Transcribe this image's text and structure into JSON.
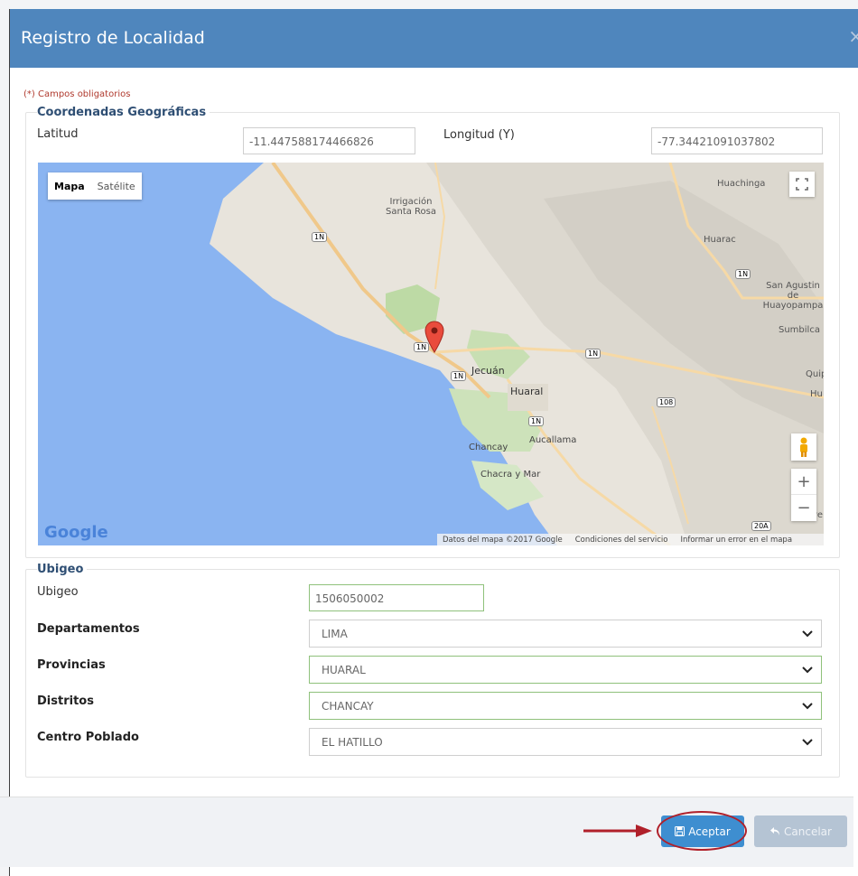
{
  "dialog": {
    "title": "Registro de Localidad",
    "close_symbol": "×",
    "required_note": "(*) Campos obligatorios"
  },
  "coords": {
    "legend": "Coordenadas Geográficas",
    "lat_label": "Latitud",
    "lat_value": "-11.447588174466826",
    "lon_label": "Longitud (Y)",
    "lon_value": "-77.34421091037802"
  },
  "map": {
    "type_map": "Mapa",
    "type_satellite": "Satélite",
    "google_logo": "Google",
    "attribution_data": "Datos del mapa ©2017 Google",
    "attribution_terms": "Condiciones del servicio",
    "attribution_report": "Informar un error en el mapa",
    "places": {
      "irrigacion_1": "Irrigación",
      "irrigacion_2": "Santa Rosa",
      "huachinga": "Huachinga",
      "huarac": "Huarac",
      "san_agustin_1": "San Agustin de",
      "san_agustin_2": "Huayopampa",
      "sumbilca": "Sumbilca",
      "jecuan": "Jecuán",
      "huaral": "Huaral",
      "quip": "Quip",
      "hu": "Hu",
      "aucallama": "Aucallama",
      "chancay": "Chancay",
      "chacra": "Chacra y Mar",
      "ve": "ve"
    },
    "shields": {
      "r1n": "1N",
      "r108": "108",
      "r20a": "20A"
    },
    "zoom_in": "+",
    "zoom_out": "−"
  },
  "ubigeo": {
    "legend": "Ubigeo",
    "ubigeo_label": "Ubigeo",
    "ubigeo_value": "1506050002",
    "departamentos_label": "Departamentos",
    "departamentos_value": "LIMA",
    "provincias_label": "Provincias",
    "provincias_value": "HUARAL",
    "distritos_label": "Distritos",
    "distritos_value": "CHANCAY",
    "centro_label": "Centro Poblado",
    "centro_value": "EL HATILLO"
  },
  "buttons": {
    "accept": "Aceptar",
    "cancel": "Cancelar"
  },
  "colors": {
    "header": "#4f86bd",
    "accept": "#3e8ed0",
    "cancel": "#b5c4d4",
    "highlight": "#b0202a",
    "valid_border": "#8fc17b"
  }
}
